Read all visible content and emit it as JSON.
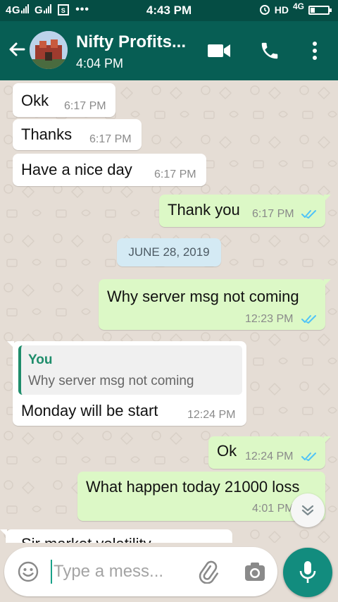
{
  "status_bar": {
    "signal_1": "4G",
    "signal_2": "G",
    "time": "4:43 PM",
    "hd_label": "HD",
    "network_label": "4G"
  },
  "header": {
    "contact_name": "Nifty Profits...",
    "last_seen": "4:04 PM"
  },
  "messages": [
    {
      "direction": "in",
      "text": "Okk",
      "time": "6:17 PM"
    },
    {
      "direction": "in",
      "text": "Thanks",
      "time": "6:17 PM"
    },
    {
      "direction": "in",
      "text": "Have a nice day",
      "time": "6:17 PM"
    },
    {
      "direction": "out",
      "text": "Thank you",
      "time": "6:17 PM",
      "status": "read"
    },
    {
      "direction": "out",
      "text": "Why server msg not coming",
      "time": "12:23 PM",
      "status": "read"
    },
    {
      "direction": "in",
      "text": "Monday will be start",
      "time": "12:24 PM",
      "quote_author": "You",
      "quote_text": "Why server msg not coming"
    },
    {
      "direction": "out",
      "text": "Ok",
      "time": "12:24 PM",
      "status": "read"
    },
    {
      "direction": "out",
      "text": "What happen today 21000 loss",
      "time": "4:01 PM",
      "status": "read"
    },
    {
      "direction": "in",
      "text": "Sir market volatility"
    }
  ],
  "date_divider": "JUNE 28, 2019",
  "composer": {
    "placeholder": "Type a mess..."
  },
  "colors": {
    "header": "#075e54",
    "status_bar": "#054d44",
    "outgoing_bubble": "#dcf8c6",
    "incoming_bubble": "#ffffff",
    "read_tick": "#4fc3f7",
    "mic_button": "#128c7e",
    "chat_background": "#e5ddd5"
  },
  "icons": [
    "back-arrow-icon",
    "video-call-icon",
    "voice-call-icon",
    "more-options-icon",
    "double-check-icon",
    "chevron-double-down-icon",
    "emoji-icon",
    "attach-icon",
    "camera-icon",
    "mic-icon"
  ]
}
